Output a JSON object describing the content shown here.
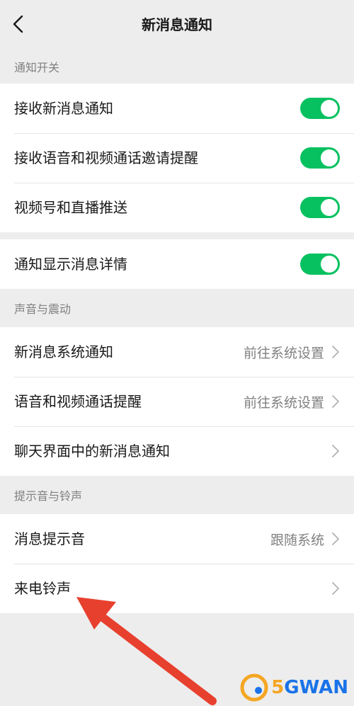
{
  "nav": {
    "title": "新消息通知"
  },
  "sections": {
    "notification_switches": "通知开关",
    "sound_vibration": "声音与震动",
    "tones_ringtones": "提示音与铃声"
  },
  "rows": {
    "receive_new_message": {
      "label": "接收新消息通知",
      "enabled": true
    },
    "receive_call_invite": {
      "label": "接收语音和视频通话邀请提醒",
      "enabled": true
    },
    "channels_live_push": {
      "label": "视频号和直播推送",
      "enabled": true
    },
    "show_message_detail": {
      "label": "通知显示消息详情",
      "enabled": true
    },
    "system_notification": {
      "label": "新消息系统通知",
      "value": "前往系统设置"
    },
    "call_reminder": {
      "label": "语音和视频通话提醒",
      "value": "前往系统设置"
    },
    "in_chat_notification": {
      "label": "聊天界面中的新消息通知"
    },
    "message_tone": {
      "label": "消息提示音",
      "value": "跟随系统"
    },
    "incoming_ringtone": {
      "label": "来电铃声"
    }
  },
  "colors": {
    "toggle_on": "#07c160",
    "arrow": "#e8402f",
    "background": "#ededed"
  },
  "watermark": {
    "digit": "5",
    "text": "GWAN"
  },
  "icons": [
    "back-icon",
    "chevron-right-icon",
    "toggle-switch"
  ]
}
